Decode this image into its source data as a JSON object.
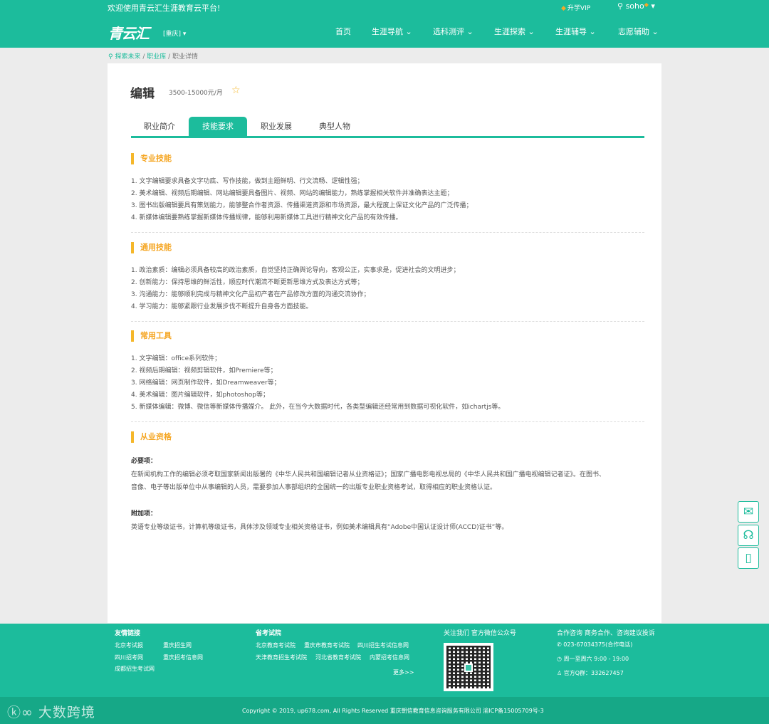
{
  "topbar": {
    "welcome": "欢迎使用青云汇生涯教育云平台!",
    "vip": "升学VIP",
    "user": "soho"
  },
  "header": {
    "logo": "青云汇",
    "city": "[重庆]",
    "nav": [
      "首页",
      "生涯导航",
      "选科测评",
      "生涯探索",
      "生涯辅导",
      "志愿辅助"
    ]
  },
  "breadcrumb": [
    "探索未来",
    "职业库",
    "职业详情"
  ],
  "job": {
    "title": "编辑",
    "salary": "3500-15000元/月"
  },
  "tabs": [
    "职业简介",
    "技能要求",
    "职业发展",
    "典型人物"
  ],
  "sections": {
    "pro": {
      "title": "专业技能",
      "items": [
        "1. 文字编辑要求具备文字功底、写作技能，做到主题鲜明、行文流畅、逻辑性强；",
        "2. 美术编辑、视频后期编辑、网站编辑要具备图片、视频、网站的编辑能力，熟练掌握相关软件并准确表达主题；",
        "3. 图书出版编辑要具有策划能力，能够整合作者资源、传播渠道资源和市场资源，最大程度上保证文化产品的广泛传播；",
        "4. 新媒体编辑要熟练掌握新媒体传播规律，能够利用新媒体工具进行精神文化产品的有效传播。"
      ]
    },
    "general": {
      "title": "通用技能",
      "items": [
        "1. 政治素质：编辑必须具备较高的政治素质，自觉坚持正确舆论导向，客观公正，实事求是，促进社会的文明进步；",
        "2. 创新能力：保持思维的鲜活性，顺应时代潮流不断更新思维方式及表达方式等；",
        "3. 沟通能力：能够顺利完成与精神文化产品初产者在产品修改方面的沟通交流协作；",
        "4. 学习能力：能够紧跟行业发展步伐不断提升自身各方面技能。"
      ]
    },
    "tools": {
      "title": "常用工具",
      "items": [
        "1. 文字编辑：office系列软件；",
        "2. 视频后期编辑：视频剪辑软件，如Premiere等；",
        "3. 网络编辑：网页制作软件，如Dreamweaver等；",
        "4. 美术编辑：图片编辑软件，如photoshop等；",
        "5. 新媒体编辑：微博、微信等新媒体传播媒介。 此外，在当今大数据时代，各类型编辑还经常用到数据可视化软件，如ichartjs等。"
      ]
    },
    "qual": {
      "title": "从业资格",
      "required_label": "必要项：",
      "required_line1": "在新闻机构工作的编辑必须考取国家新闻出版署的《中华人民共和国编辑记者从业资格证》；国家广播电影电视总局的《中华人民共和国广播电视编辑记者证》。在图书、",
      "required_line2": "音像、电子等出版单位中从事编辑的人员，需要参加人事部组织的全国统一的出版专业职业资格考试，取得相应的职业资格认证。",
      "extra_label": "附加项：",
      "extra_text": "英语专业等级证书，计算机等级证书，具体涉及领域专业相关资格证书，例如美术编辑具有“Adobe中国认证设计师(ACCD)证书”等。"
    }
  },
  "footer": {
    "friend_title": "友情链接",
    "friend_links": [
      "北京考试报",
      "重庆招生网",
      "四川招考网",
      "重庆招考信息网",
      "成都招生考试网"
    ],
    "exam_title": "省考试院",
    "exam_links": [
      "北京教育考试院",
      "重庆市教育考试院",
      "四川招生考试信息网",
      "天津教育招生考试院",
      "河北省教育考试院",
      "内蒙招考信息网"
    ],
    "more": "更多>>",
    "follow_title": "关注我们 官方微信公众号",
    "contact_title": "合作咨询 商务合作、咨询建议投诉",
    "phone": "023-67034375(合作电话)",
    "hours": "周一至周六 9:00 - 19:00",
    "qq": "官方Q群：332627457",
    "copyright": "Copyright © 2019, up678.com, All Rights Reserved 重庆朝信教育信息咨询服务有限公司 渝ICP备15005709号-3"
  },
  "watermark": "大数跨境",
  "icons": {
    "wechat": "wechat-icon",
    "service": "customer-service-icon",
    "mobile": "mobile-icon"
  },
  "colors": {
    "primary": "#1cbc9c",
    "accent": "#f5b72a"
  }
}
